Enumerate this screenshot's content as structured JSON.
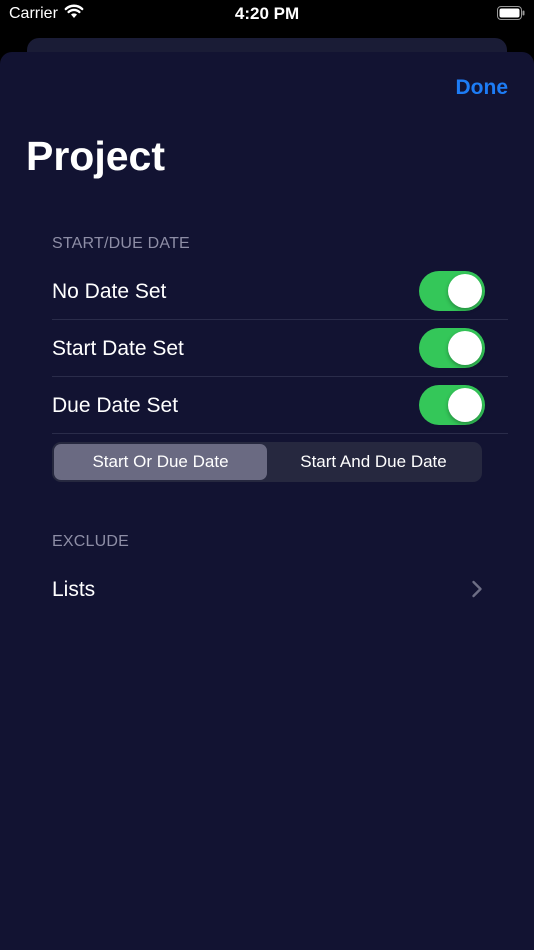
{
  "status_bar": {
    "carrier": "Carrier",
    "time": "4:20 PM"
  },
  "nav": {
    "done_label": "Done",
    "title": "Project"
  },
  "sections": {
    "dates": {
      "header": "START/DUE DATE",
      "rows": [
        {
          "label": "No Date Set",
          "on": true
        },
        {
          "label": "Start Date Set",
          "on": true
        },
        {
          "label": "Due Date Set",
          "on": true
        }
      ],
      "segments": [
        {
          "label": "Start Or Due Date",
          "selected": true
        },
        {
          "label": "Start And Due Date",
          "selected": false
        }
      ]
    },
    "exclude": {
      "header": "EXCLUDE",
      "lists_label": "Lists"
    }
  },
  "colors": {
    "background": "#121332",
    "accent": "#1d7cf5",
    "toggle_on": "#34c759"
  }
}
